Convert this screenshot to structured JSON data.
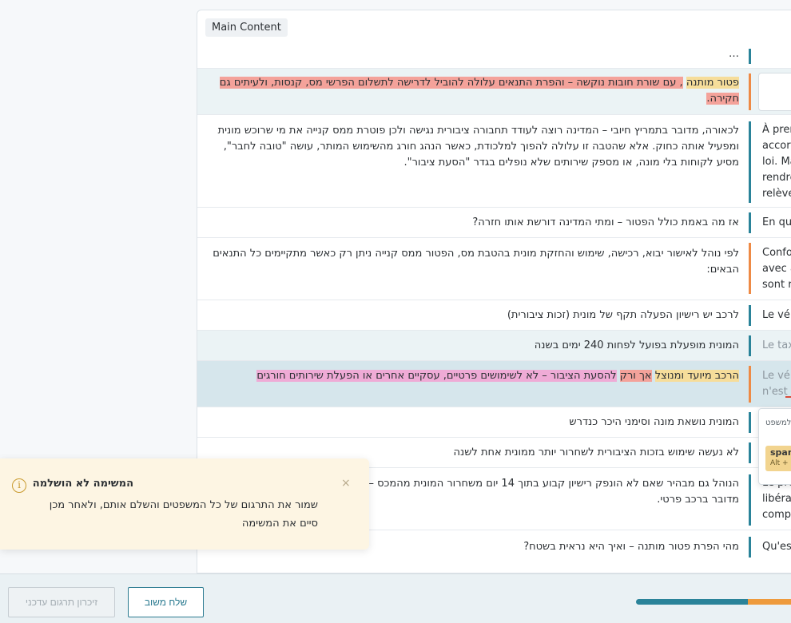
{
  "panel": {
    "title": "Main Content"
  },
  "rows": [
    {
      "id": "r0",
      "source": "…",
      "target": "",
      "bar": "teal"
    },
    {
      "id": "r1",
      "source_parts": [
        {
          "text": "פטור מותנה",
          "mark": "y"
        },
        {
          "text": " ",
          "mark": ""
        },
        {
          "text": ", עם שורת חובות נוקשה – והפרת התנאים עלולה להוביל לדרישה לתשלום הפרשי מס, קנסות, ולעיתים גם חקירה.",
          "mark": "r"
        }
      ],
      "target": "",
      "bar": "orange"
    },
    {
      "id": "r2",
      "source": "לכאורה, מדובר בתמריץ חיובי – המדינה רוצה לעודד תחבורה ציבורית נגישה ולכן פוטרת ממס קנייה את מי שרוכש מונית ומפעיל אותה כחוק. אלא שהטבה זו עלולה להפוך למלכודת, כאשר הנהג חורג מהשימוש המותר, עושה \"טובה לחבר\", מסיע לקוחות בלי מונה, או מספק שירותים שלא נופלים בגדר \"הסעת ציבור\".",
      "target_lines": [
        "À premi",
        "accorde",
        "loi. Ma",
        "rendre",
        "relève"
      ],
      "bar": "teal"
    },
    {
      "id": "r3",
      "source": "אז מה באמת כולל הפטור – ומתי המדינה דורשת אותו חזרה?",
      "target": "En que",
      "bar": "teal"
    },
    {
      "id": "r4",
      "source": "לפי נוהל לאישור יבוא, רכישה, שימוש והחזקת מונית בהטבת מס, הפטור ממס קנייה ניתן רק כאשר מתקיימים כל התנאים הבאים:",
      "target_lines": [
        "Confo",
        "avec a",
        "sont r"
      ],
      "bar": "orange"
    },
    {
      "id": "r5",
      "source": "לרכב יש רישיון הפעלה תקף של מונית (זכות ציבורית)",
      "target": "Le véh",
      "bar": "teal"
    },
    {
      "id": "r6",
      "source": "המונית מופעלת בפועל לפחות 240 ימים בשנה",
      "target": "Le tax",
      "bar": "teal"
    },
    {
      "id": "r7",
      "source_parts": [
        {
          "text": "הרכב מיועד ומנוצל",
          "mark": "y"
        },
        {
          "text": " ",
          "mark": ""
        },
        {
          "text": "אך ורק",
          "mark": "r"
        },
        {
          "text": " ",
          "mark": ""
        },
        {
          "text": "להסעת הציבור – לא לשימושים פרטיים, עסקיים אחרים או הפעלת שירותים חורגים",
          "mark": "p"
        }
      ],
      "target_lines": [
        "Le véh",
        "n'est a"
      ],
      "bar": "orange"
    },
    {
      "id": "r8",
      "source": "המונית נושאת מונה וסימני היכר כנדרש",
      "target": "",
      "bar": "teal"
    },
    {
      "id": "r9",
      "source": "לא נעשה שימוש בזכות הציבורית לשחרור יותר ממונית אחת לשנה",
      "target": "",
      "bar": "teal"
    },
    {
      "id": "r10",
      "source": "הנוהל גם מבהיר שאם לא הונפק רישיון קבוע בתוך 14 יום משחרור המונית מהמכס – יש לשלם את מלוא המס כאילו מדובר ברכב פרטי.",
      "target_lines": [
        "Le pré",
        "libérat",
        "comp"
      ],
      "bar": "teal"
    },
    {
      "id": "r11",
      "source": "מהי הפרת פטור מותנה – ואיך היא נראית בשטח?",
      "target": "Qu'est",
      "bar": "teal"
    }
  ],
  "popup": {
    "label": "למשפט",
    "chip_title": "span",
    "chip_shortcut": "Alt +"
  },
  "toast": {
    "title": "המשימה לא הושלמה",
    "body": "שמור את התרגום של כל המשפטים והשלם אותם, ולאחר מכן סיים את המשימה",
    "icon": "info-icon",
    "close": "×"
  },
  "bottom": {
    "memory_button": "זיכרון תרגום עדכני",
    "feedback_button": "שלח משוב",
    "progress": {
      "primary_percent": 72,
      "secondary_percent": 28
    }
  },
  "colors": {
    "accent": "#2a8399",
    "warning": "#ee8a45",
    "mark_yellow": "#f6dd9a",
    "mark_red": "#f4a29a",
    "mark_pink": "#efabd6"
  }
}
